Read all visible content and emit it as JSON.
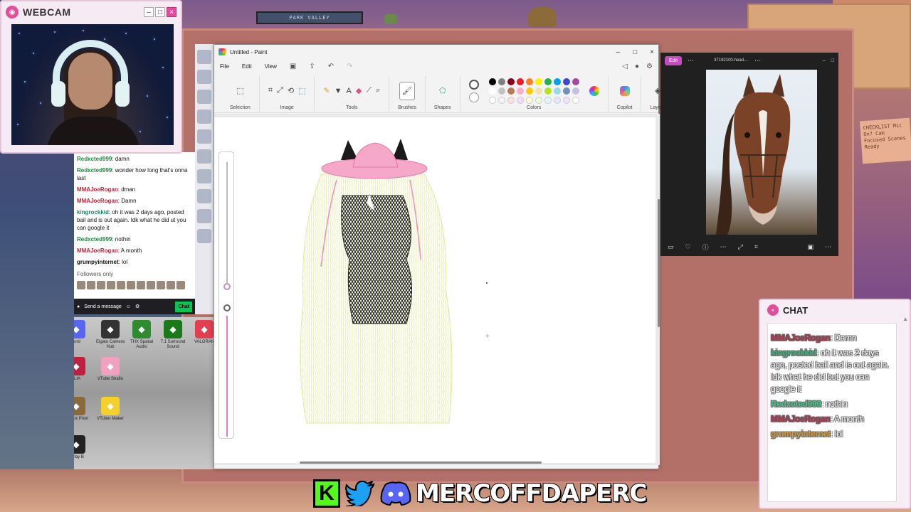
{
  "webcam": {
    "title": "WEBCAM"
  },
  "left_chat": {
    "messages": [
      {
        "user": "Redxcted999",
        "text": ": damn"
      },
      {
        "user": "Redxcted999",
        "text": ": wonder how long that's onna last"
      },
      {
        "user": "MMAJoeRogan",
        "text": ": dman"
      },
      {
        "user": "MMAJoeRogan",
        "text": ": Damn"
      },
      {
        "user": "kingrockkid",
        "text": ": oh it was 2 days ago, posted bail and is out again. Idk what he did ut you can google it"
      },
      {
        "user": "Redxcted999",
        "text": ": nothin"
      },
      {
        "user": "MMAJoeRogan",
        "text": ": A month"
      },
      {
        "user": "grumpyinternet",
        "text": ": lol"
      }
    ],
    "followers_only": "Followers only",
    "input_placeholder": "Send a message",
    "chat_button": "Chat"
  },
  "desktop_icons": [
    {
      "label": "cord",
      "name": "discord-desktop-icon",
      "color": "#5865f2"
    },
    {
      "label": "Elgato Camera Hub",
      "name": "elgato-camera-hub-icon",
      "color": "#333333"
    },
    {
      "label": "THX Spatial Audio",
      "name": "thx-spatial-audio-icon",
      "color": "#2e8b2e"
    },
    {
      "label": "7.1 Surround Sound",
      "name": "surround-sound-icon",
      "color": "#1a7a1a"
    },
    {
      "label": "VALORAN",
      "name": "valorant-icon",
      "color": "#e04050"
    },
    {
      "label": "JLIA",
      "name": "jlia-icon",
      "color": "#c02040"
    },
    {
      "label": "VTube Studio",
      "name": "vtube-studio-icon",
      "color": "#f2a0c0"
    },
    {
      "label": "ackbox Pixel",
      "name": "blackbox-icon",
      "color": "#8a6a3a"
    },
    {
      "label": "VTuber Maker",
      "name": "vtuber-maker-icon",
      "color": "#f5d02a"
    },
    {
      "label": "verlay B",
      "name": "overlay-icon",
      "color": "#222222"
    }
  ],
  "paint": {
    "title": "Untitled - Paint",
    "menu": {
      "file": "File",
      "edit": "Edit",
      "view": "View"
    },
    "ribbon": {
      "selection": "Selection",
      "image": "Image",
      "tools": "Tools",
      "brushes": "Brushes",
      "shapes": "Shapes",
      "colors": "Colors",
      "copilot": "Copilot",
      "layers": "Layers"
    },
    "palette": [
      "#000000",
      "#7f7f7f",
      "#880015",
      "#ed1c24",
      "#ff7f27",
      "#fff200",
      "#22b14c",
      "#00a2e8",
      "#3f48cc",
      "#a349a4",
      "#ffffff",
      "#c3c3c3",
      "#b97a57",
      "#ffaec9",
      "#ffc90e",
      "#efe4b0",
      "#b5e61d",
      "#99d9ea",
      "#7092be",
      "#c8bfe7",
      "#ffffff",
      "#f4f4f4",
      "#ffdede",
      "#f7d9ff",
      "#fff8d6",
      "#e8ffd8",
      "#dff7ff",
      "#e0e8ff",
      "#f0e0ff",
      "#ffffff"
    ]
  },
  "photos": {
    "edit": "Edit",
    "filename": "37192100-head-..."
  },
  "chat": {
    "title": "CHAT",
    "messages": [
      {
        "user": "MMAJoeRogan",
        "text": ": Damn",
        "color": "#b0304a"
      },
      {
        "user": "kingrockkid",
        "text": ": oh it was 2 days ago, posted bail and is out again. Idk what he did but you can google it",
        "color": "#3ab07a"
      },
      {
        "user": "Redxcted999",
        "text": ": nothin",
        "color": "#4ac08a"
      },
      {
        "user": "MMAJoeRogan",
        "text": ": A month",
        "color": "#b0304a"
      },
      {
        "user": "grumpyinternet",
        "text": ": lol",
        "color": "#d49a3a"
      }
    ]
  },
  "background": {
    "sign": "PARK VALLEY",
    "sticky_note": "CHECKLIST Mic On? Cam Focused Scenes Ready"
  },
  "social": {
    "handle": "MERCOFFDAPERC",
    "kick_letter": "K"
  }
}
